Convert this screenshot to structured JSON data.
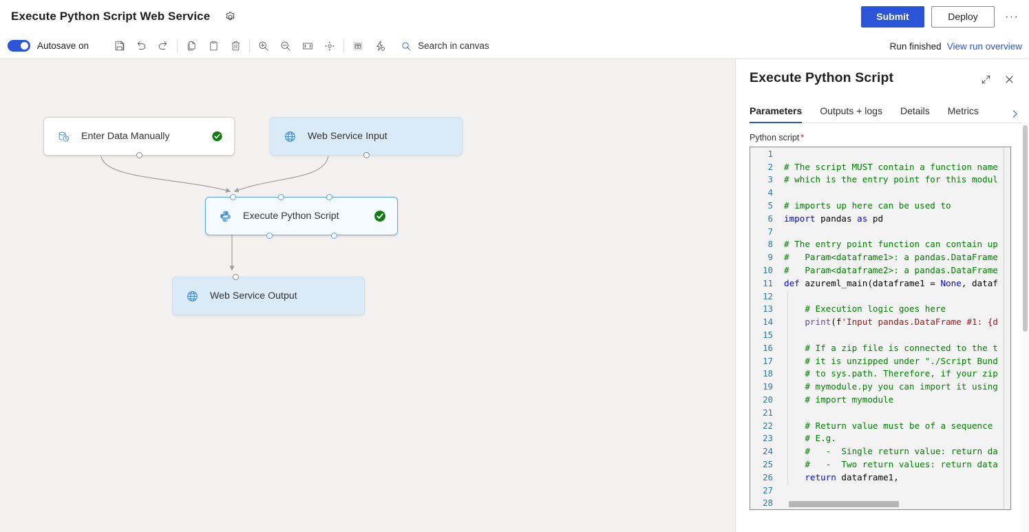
{
  "topbar": {
    "title": "Execute Python Script Web Service",
    "settings_icon": "gear-icon",
    "submit_label": "Submit",
    "deploy_label": "Deploy",
    "more_label": "···"
  },
  "commandbar": {
    "autosave_label": "Autosave on",
    "autosave_on": true,
    "tools": [
      {
        "name": "save-icon",
        "title": "Save"
      },
      {
        "name": "undo-icon",
        "title": "Undo"
      },
      {
        "name": "redo-icon",
        "title": "Redo"
      },
      {
        "name": "copy-icon",
        "title": "Copy"
      },
      {
        "name": "paste-icon",
        "title": "Paste"
      },
      {
        "name": "delete-icon",
        "title": "Delete"
      },
      {
        "name": "zoom-in-icon",
        "title": "Zoom in"
      },
      {
        "name": "zoom-out-icon",
        "title": "Zoom out"
      },
      {
        "name": "fit-to-screen-icon",
        "title": "Fit to screen"
      },
      {
        "name": "reset-view-icon",
        "title": "Reset view"
      },
      {
        "name": "auto-layout-icon",
        "title": "Auto layout"
      },
      {
        "name": "run-settings-icon",
        "title": "Run settings"
      }
    ],
    "search_placeholder": "Search in canvas",
    "search_value": "",
    "search_icon": "search-icon",
    "run_status": "Run finished",
    "run_link": "View run overview"
  },
  "canvas": {
    "nodes": [
      {
        "id": "enter-data-manually",
        "label": "Enter Data Manually",
        "icon": "enter-data-icon",
        "status": "succeeded",
        "style": "plain"
      },
      {
        "id": "web-service-input",
        "label": "Web Service Input",
        "icon": "globe-icon",
        "status": "",
        "style": "webservice"
      },
      {
        "id": "execute-python-script",
        "label": "Execute Python Script",
        "icon": "python-icon",
        "status": "succeeded",
        "style": "selected"
      },
      {
        "id": "web-service-output",
        "label": "Web Service Output",
        "icon": "globe-icon",
        "status": "",
        "style": "webservice"
      }
    ],
    "status_color_success": "#107c10",
    "selected_border_color": "#59a7e8"
  },
  "panel": {
    "title": "Execute Python Script",
    "expand_icon": "expand-icon",
    "close_icon": "close-icon",
    "tabs": [
      {
        "label": "Parameters",
        "active": true
      },
      {
        "label": "Outputs + logs",
        "active": false
      },
      {
        "label": "Details",
        "active": false
      },
      {
        "label": "Metrics",
        "active": false
      }
    ],
    "tab_overflow_icon": "chevron-right-icon",
    "field_label": "Python script",
    "field_required_marker": "*",
    "code_lines": [
      {
        "n": 1,
        "html": ""
      },
      {
        "n": 2,
        "html": "<span class='tok-com'># The script MUST contain a function name</span>"
      },
      {
        "n": 3,
        "html": "<span class='tok-com'># which is the entry point for this modul</span>"
      },
      {
        "n": 4,
        "html": ""
      },
      {
        "n": 5,
        "html": "<span class='tok-com'># imports up here can be used to</span>"
      },
      {
        "n": 6,
        "html": "<span class='tok-kw'>import</span> pandas <span class='tok-kw'>as</span> pd"
      },
      {
        "n": 7,
        "html": ""
      },
      {
        "n": 8,
        "html": "<span class='tok-com'># The entry point function can contain up</span>"
      },
      {
        "n": 9,
        "html": "<span class='tok-com'>#   Param&lt;dataframe1&gt;: a pandas.DataFrame</span>"
      },
      {
        "n": 10,
        "html": "<span class='tok-com'>#   Param&lt;dataframe2&gt;: a pandas.DataFrame</span>"
      },
      {
        "n": 11,
        "html": "<span class='tok-kw'>def</span> azureml_main(dataframe1 = <span class='tok-const'>None</span>, dataf"
      },
      {
        "n": 12,
        "html": ""
      },
      {
        "n": 13,
        "html": "    <span class='tok-com'># Execution logic goes here</span>"
      },
      {
        "n": 14,
        "html": "    <span class='tok-fn'>print</span>(f<span class='tok-str'>'Input pandas.DataFrame #1: {d</span>"
      },
      {
        "n": 15,
        "html": ""
      },
      {
        "n": 16,
        "html": "    <span class='tok-com'># If a zip file is connected to the t</span>"
      },
      {
        "n": 17,
        "html": "    <span class='tok-com'># it is unzipped under \"./Script Bund</span>"
      },
      {
        "n": 18,
        "html": "    <span class='tok-com'># to sys.path. Therefore, if your zip</span>"
      },
      {
        "n": 19,
        "html": "    <span class='tok-com'># mymodule.py you can import it using</span>"
      },
      {
        "n": 20,
        "html": "    <span class='tok-com'># import mymodule</span>"
      },
      {
        "n": 21,
        "html": ""
      },
      {
        "n": 22,
        "html": "    <span class='tok-com'># Return value must be of a sequence</span>"
      },
      {
        "n": 23,
        "html": "    <span class='tok-com'># E.g.</span>"
      },
      {
        "n": 24,
        "html": "    <span class='tok-com'>#   -  Single return value: return da</span>"
      },
      {
        "n": 25,
        "html": "    <span class='tok-com'>#   -  Two return values: return data</span>"
      },
      {
        "n": 26,
        "html": "    <span class='tok-kw'>return</span> dataframe1,"
      },
      {
        "n": 27,
        "html": ""
      },
      {
        "n": 28,
        "html": ""
      }
    ]
  },
  "colors": {
    "accent": "#2b55d9",
    "success": "#107c10",
    "canvas_bg": "#f3f2f1",
    "node_ws_bg": "#daeaf7",
    "comment_green": "#008000"
  }
}
